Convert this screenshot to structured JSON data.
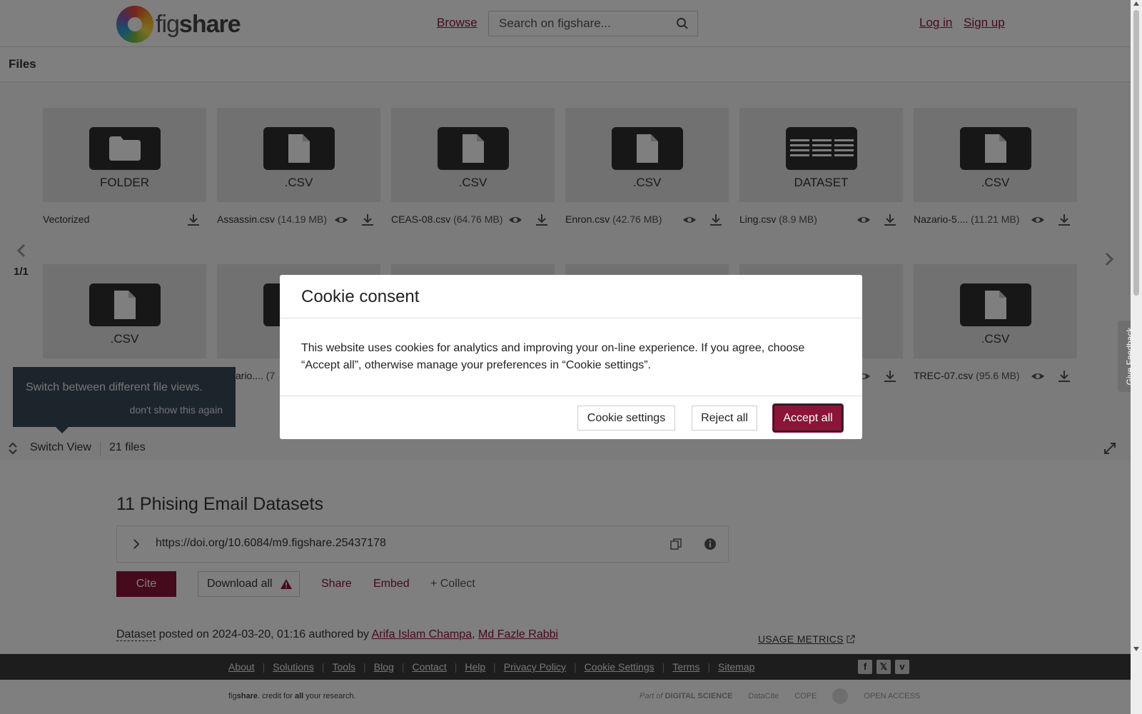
{
  "header": {
    "logo_prefix": "fig",
    "logo_suffix": "share",
    "browse": "Browse",
    "search_placeholder": "Search on figshare...",
    "login": "Log in",
    "signup": "Sign up"
  },
  "files_panel": {
    "title": "Files",
    "pager": "1/1",
    "row1": [
      {
        "type": "FOLDER",
        "name": "Vectorized",
        "size": ""
      },
      {
        "type": ".CSV",
        "name": "Assassin.csv",
        "size": "(14.19 MB)"
      },
      {
        "type": ".CSV",
        "name": "CEAS-08.csv",
        "size": "(64.76 MB)"
      },
      {
        "type": ".CSV",
        "name": "Enron.csv",
        "size": "(42.76 MB)"
      },
      {
        "type": "DATASET",
        "name": "Ling.csv",
        "size": "(8.9 MB)"
      },
      {
        "type": ".CSV",
        "name": "Nazario-5....",
        "size": "(11.21 MB)"
      }
    ],
    "row2": [
      {
        "type": ".CSV",
        "name": "",
        "size": ""
      },
      {
        "type": "",
        "name": "ario....",
        "size": "(7"
      },
      {
        "type": "",
        "name": "",
        "size": ""
      },
      {
        "type": "",
        "name": "",
        "size": ""
      },
      {
        "type": "",
        "name": "",
        "size": ""
      },
      {
        "type": ".CSV",
        "name": "TREC-07.csv",
        "size": "(95.6 MB)"
      }
    ],
    "tooltip": {
      "text": "Switch between different file views.",
      "dismiss": "don't show this again"
    },
    "switch_view": "Switch View",
    "file_count": "21 files"
  },
  "article": {
    "title": "11 Phising Email Datasets",
    "doi": "https://doi.org/10.6084/m9.figshare.25437178",
    "cite": "Cite",
    "download_all": "Download all",
    "share": "Share",
    "embed": "Embed",
    "collect": "+ Collect",
    "item_type": "Dataset",
    "posted_text": "posted on 2024-03-20, 01:16 authored by",
    "author1": "Arifa Islam Champa",
    "author_sep": ",",
    "author2": "Md Fazle Rabbi",
    "usage_metrics": "USAGE METRICS"
  },
  "footer": {
    "links": [
      "About",
      "Solutions",
      "Tools",
      "Blog",
      "Contact",
      "Help",
      "Privacy Policy",
      "Cookie Settings",
      "Terms",
      "Sitemap"
    ],
    "tagline_prefix": "fig",
    "tagline_brand": "share",
    "tagline_mid": ". credit for ",
    "tagline_bold": "all",
    "tagline_end": " your research.",
    "partner_part_of": "Part of",
    "partner_ds": "DIGITAL SCIENCE",
    "partner_datacite": "DataCite",
    "partner_cope": "COPE",
    "partner_oa": "OPEN ACCESS"
  },
  "cookie_modal": {
    "title": "Cookie consent",
    "body": "This website uses cookies for analytics and improving your on-line experience. If you agree, choose “Accept all”, otherwise manage your preferences in “Cookie settings”.",
    "settings": "Cookie settings",
    "reject": "Reject all",
    "accept": "Accept all"
  },
  "feedback": "Give Feedback",
  "colors": {
    "brand": "#8a1538",
    "tile": "#e3e3e3",
    "footer": "#3a3a3a"
  }
}
